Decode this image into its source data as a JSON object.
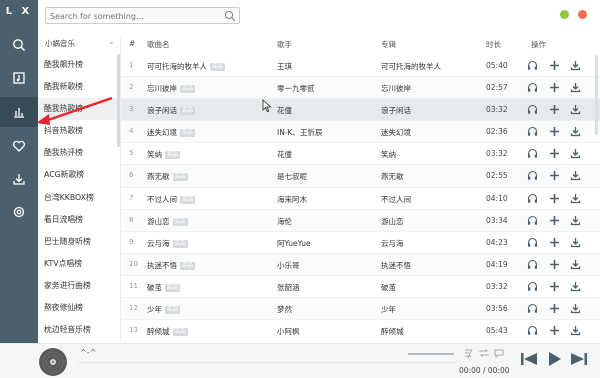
{
  "app": {
    "brand": "L X"
  },
  "search": {
    "placeholder": "Search for something..."
  },
  "sidebar": {
    "source_label": "小蜗音乐",
    "items": [
      "酷我飙升榜",
      "酷我新歌榜",
      "酷我热歌榜",
      "抖音热歌榜",
      "酷我热评榜",
      "ACG新歌榜",
      "台湾KKBOX榜",
      "看日流唱榜",
      "巴士随身听榜",
      "KTV点唱榜",
      "家务进行曲榜",
      "熬夜修仙榜",
      "枕边轻音乐榜"
    ],
    "active_index": 2
  },
  "table": {
    "headers": {
      "num": "#",
      "title": "歌曲名",
      "artist": "歌手",
      "album": "专辑",
      "duration": "时长",
      "actions": "操作"
    },
    "tag_label": "高品",
    "rows": [
      {
        "num": "1",
        "title": "可可托海的牧羊人",
        "tag": true,
        "artist": "王琪",
        "album": "可可托海的牧羊人",
        "duration": "05:40"
      },
      {
        "num": "2",
        "title": "忘川彼岸",
        "tag": true,
        "artist": "零一九零贰",
        "album": "忘川彼岸",
        "duration": "02:57"
      },
      {
        "num": "3",
        "title": "浪子闲话",
        "tag": true,
        "artist": "花僮",
        "album": "浪子闲话",
        "duration": "03:32"
      },
      {
        "num": "4",
        "title": "迷失幻境",
        "tag": true,
        "artist": "IN-K、王忻辰",
        "album": "迷失幻境",
        "duration": "02:36"
      },
      {
        "num": "5",
        "title": "笑纳",
        "tag": true,
        "artist": "花僮",
        "album": "笑纳",
        "duration": "03:32"
      },
      {
        "num": "6",
        "title": "燕无歇",
        "tag": true,
        "artist": "是七叔呢",
        "album": "燕无歇",
        "duration": "02:55"
      },
      {
        "num": "7",
        "title": "不过人间",
        "tag": true,
        "artist": "海来阿木",
        "album": "不过人间",
        "duration": "04:10"
      },
      {
        "num": "8",
        "title": "游山恋",
        "tag": true,
        "artist": "海伦",
        "album": "游山恋",
        "duration": "03:34"
      },
      {
        "num": "9",
        "title": "云与海",
        "tag": true,
        "artist": "阿YueYue",
        "album": "云与海",
        "duration": "04:23"
      },
      {
        "num": "10",
        "title": "执迷不悟",
        "tag": true,
        "artist": "小乐哥",
        "album": "执迷不悟",
        "duration": "04:19"
      },
      {
        "num": "11",
        "title": "破茧",
        "tag": true,
        "artist": "张韶涵",
        "album": "破茧",
        "duration": "03:32"
      },
      {
        "num": "12",
        "title": "少年",
        "tag": true,
        "artist": "梦然",
        "album": "少年",
        "duration": "03:56"
      },
      {
        "num": "13",
        "title": "醉倾城",
        "tag": true,
        "artist": "小阿枫",
        "album": "醉倾城",
        "duration": "05:43"
      }
    ],
    "selected_index": 2
  },
  "player": {
    "title": "^-^",
    "time": "00:00 / 00:00",
    "volume_level": 1.0
  },
  "icons": {
    "rail": [
      "search-icon",
      "chart-icon",
      "leaderboard-icon",
      "heart-icon",
      "download-icon",
      "settings-icon"
    ],
    "row_actions": [
      "headphones-icon",
      "add-icon",
      "download-icon"
    ]
  },
  "colors": {
    "rail_bg": "#4c5f6c",
    "rail_active": "#394b57",
    "accent_min": "#8dc63f",
    "accent_close": "#f26b4f",
    "annotation": "#e8262b"
  }
}
